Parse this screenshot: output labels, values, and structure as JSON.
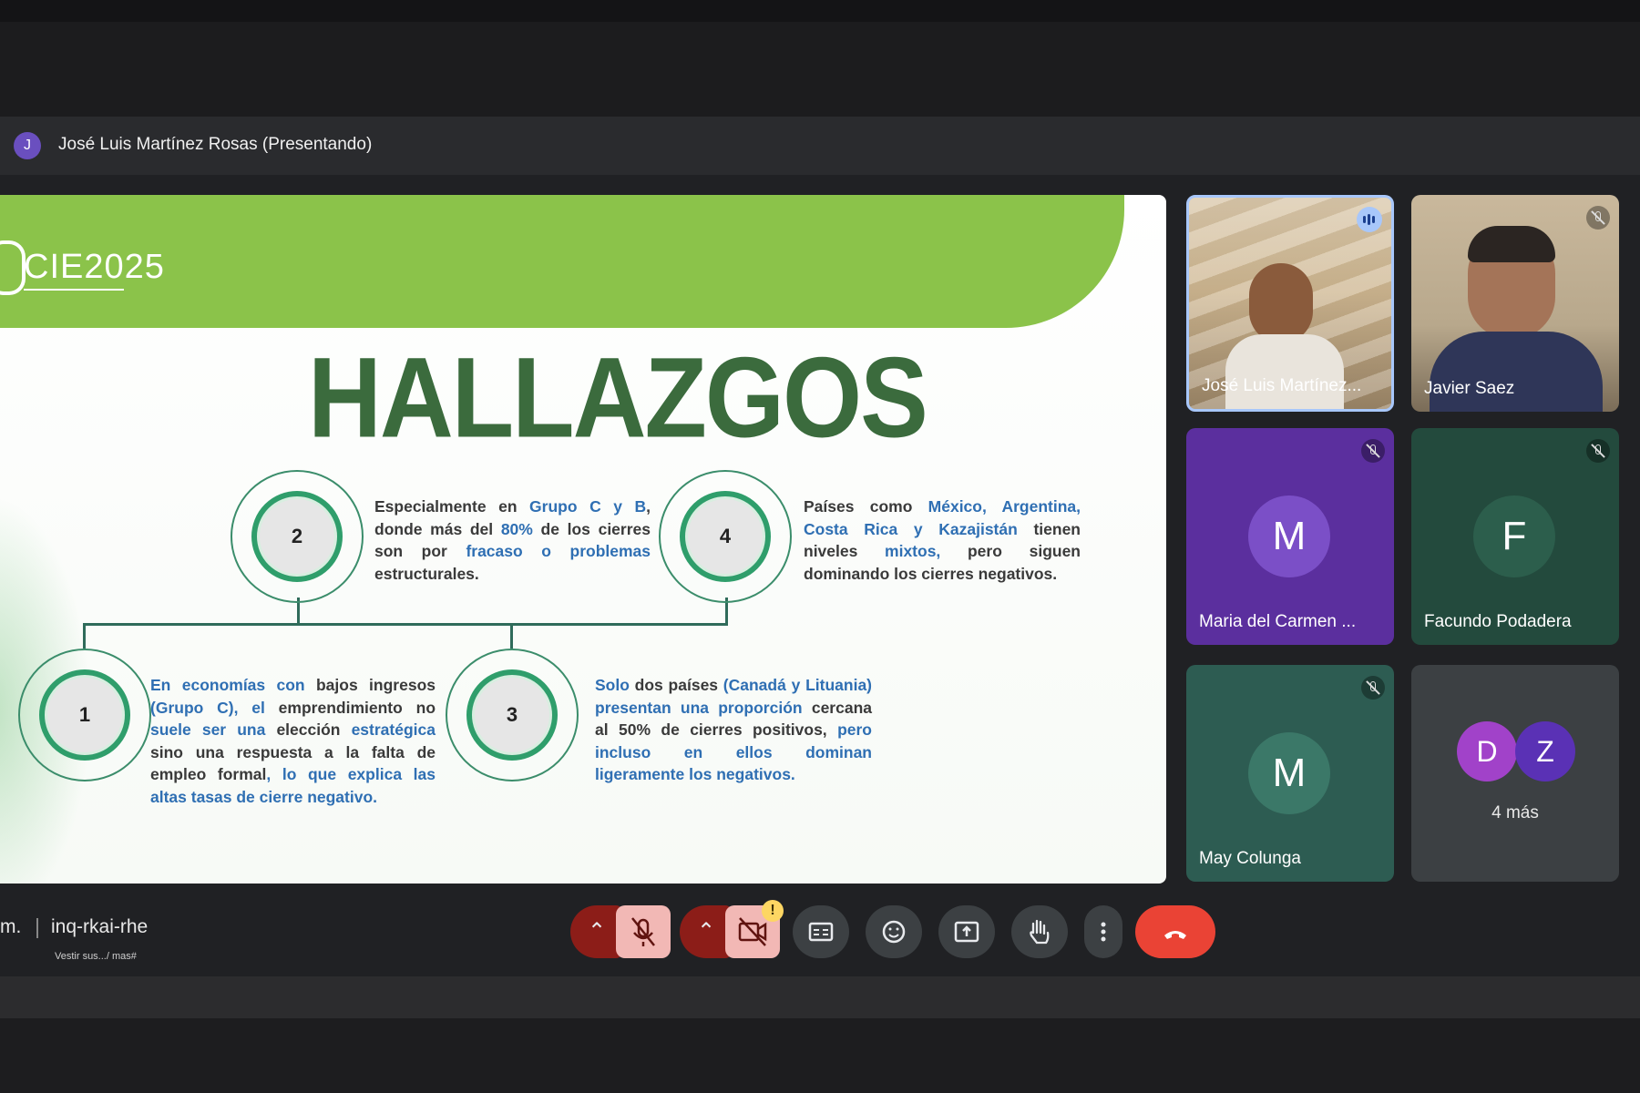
{
  "presenter": {
    "avatar_letter": "J",
    "label": "José Luis Martínez Rosas (Presentando)"
  },
  "slide": {
    "logo": "CIE2025",
    "title": "HALLAZGOS",
    "findings": [
      {
        "number": "2",
        "parts": [
          {
            "t": "Especialmente en ",
            "hl": false
          },
          {
            "t": "Grupo C y B",
            "hl": true
          },
          {
            "t": ", donde más del ",
            "hl": false
          },
          {
            "t": "80%",
            "hl": true
          },
          {
            "t": " de los cierres son por ",
            "hl": false
          },
          {
            "t": "fracaso o problemas",
            "hl": true
          },
          {
            "t": " estructurales.",
            "hl": false
          }
        ]
      },
      {
        "number": "4",
        "parts": [
          {
            "t": "Países como ",
            "hl": false
          },
          {
            "t": "México, Argentina, Costa Rica y Kazajistán",
            "hl": true
          },
          {
            "t": " tienen niveles ",
            "hl": false
          },
          {
            "t": "mixtos,",
            "hl": true
          },
          {
            "t": " pero siguen dominando los cierres negativos.",
            "hl": false
          }
        ]
      },
      {
        "number": "1",
        "parts": [
          {
            "t": "En economías con",
            "hl": true
          },
          {
            "t": " bajos ingresos ",
            "hl": false
          },
          {
            "t": "(Grupo C), el",
            "hl": true
          },
          {
            "t": " emprendimiento no ",
            "hl": false
          },
          {
            "t": "suele ser una",
            "hl": true
          },
          {
            "t": " elección ",
            "hl": false
          },
          {
            "t": "estratégica",
            "hl": true
          },
          {
            "t": " sino una respuesta a la falta de empleo formal",
            "hl": false
          },
          {
            "t": ", lo que explica las altas tasas de cierre negativo.",
            "hl": true
          }
        ]
      },
      {
        "number": "3",
        "parts": [
          {
            "t": "Solo",
            "hl": true
          },
          {
            "t": " dos países ",
            "hl": false
          },
          {
            "t": "(Canadá y Lituania) presentan una proporción",
            "hl": true
          },
          {
            "t": " cercana al 50% de cierres positivos, ",
            "hl": false
          },
          {
            "t": "pero incluso en ellos dominan ligeramente los negativos.",
            "hl": true
          }
        ]
      }
    ]
  },
  "participants": [
    {
      "name": "José Luis Martínez...",
      "type": "video",
      "state": "speaking"
    },
    {
      "name": "Javier Saez",
      "type": "video",
      "state": "muted"
    },
    {
      "name": "Maria del Carmen ...",
      "type": "avatar",
      "letter": "M",
      "bg": "#5b2f9e",
      "avatar_color": "#7b4fc7",
      "state": "muted"
    },
    {
      "name": "Facundo Podadera",
      "type": "avatar",
      "letter": "F",
      "bg": "#234a3d",
      "avatar_color": "#2c5e4c",
      "state": "muted"
    },
    {
      "name": "May Colunga",
      "type": "avatar",
      "letter": "M",
      "bg": "#2d5c52",
      "avatar_color": "#3b7868",
      "state": "muted"
    },
    {
      "name": "4 más",
      "type": "more",
      "letters": [
        "D",
        "Z"
      ],
      "colors": [
        "#a142c9",
        "#5a31b5"
      ]
    }
  ],
  "meeting": {
    "time_suffix": "m.",
    "code": "inq-rkai-rhe",
    "subtitle": "Vestir sus.../ mas#"
  },
  "controls": {
    "warning_badge": "!",
    "colors": {
      "hangup": "#ea4335",
      "muted_bg": "#f2b8b5",
      "grey": "#3c4043"
    }
  }
}
